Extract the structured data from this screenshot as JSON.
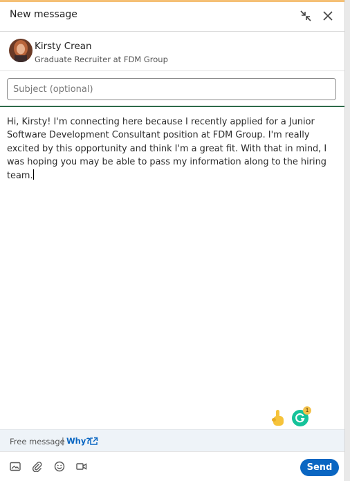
{
  "header": {
    "title": "New message",
    "minimize_icon": "minimize-arrows-icon",
    "close_icon": "close-icon"
  },
  "recipient": {
    "name": "Kirsty Crean",
    "headline": "Graduate Recruiter at FDM Group"
  },
  "subject": {
    "placeholder": "Subject (optional)",
    "value": ""
  },
  "message": {
    "body": "Hi, Kirsty! I'm connecting here because I recently applied for a Junior Software Development Consultant position at FDM Group. I'm really excited by this opportunity and think I'm a great fit. With that in mind, I was hoping you may be able to pass my information along to the hiring team."
  },
  "assist": {
    "grammarly_badge": "1"
  },
  "footer": {
    "free_message": "Free message",
    "separator": "|",
    "why_link": "Why?"
  },
  "toolbar": {
    "send_label": "Send",
    "icons": [
      "image-icon",
      "attachment-icon",
      "emoji-icon",
      "video-icon"
    ]
  },
  "colors": {
    "accent_top": "#f5c075",
    "send_blue": "#0a66c2",
    "green_divider": "#2e6b4a",
    "grammarly_green": "#15c39a"
  }
}
